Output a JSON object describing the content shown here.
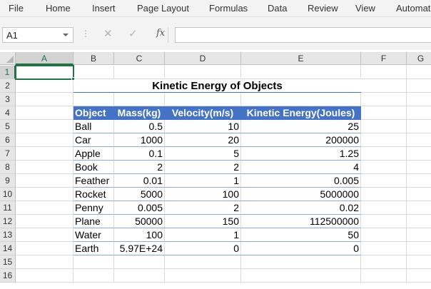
{
  "menu": [
    "File",
    "Home",
    "Insert",
    "Page Layout",
    "Formulas",
    "Data",
    "Review",
    "View",
    "Automat"
  ],
  "formula_bar": {
    "name_box": "A1",
    "cancel_icon": "✕",
    "enter_icon": "✓",
    "fx_label": "fx",
    "formula": ""
  },
  "columns": [
    "A",
    "B",
    "C",
    "D",
    "E",
    "F",
    "G"
  ],
  "rows": [
    "1",
    "2",
    "3",
    "4",
    "5",
    "6",
    "7",
    "8",
    "9",
    "10",
    "11",
    "12",
    "13",
    "14",
    "15",
    "16"
  ],
  "sheet": {
    "title": "Kinetic Energy of Objects",
    "headers": [
      "Object",
      "Mass(kg)",
      "Velocity(m/s)",
      "Kinetic Energy(Joules)"
    ],
    "data": [
      [
        "Ball",
        "0.5",
        "10",
        "25"
      ],
      [
        "Car",
        "1000",
        "20",
        "200000"
      ],
      [
        "Apple",
        "0.1",
        "5",
        "1.25"
      ],
      [
        "Book",
        "2",
        "2",
        "4"
      ],
      [
        "Feather",
        "0.01",
        "1",
        "0.005"
      ],
      [
        "Rocket",
        "5000",
        "100",
        "5000000"
      ],
      [
        "Penny",
        "0.005",
        "2",
        "0.02"
      ],
      [
        "Plane",
        "50000",
        "150",
        "112500000"
      ],
      [
        "Water",
        "100",
        "1",
        "50"
      ],
      [
        "Earth",
        "5.97E+24",
        "0",
        "0"
      ]
    ]
  },
  "colors": {
    "accent": "#217346",
    "table_header": "#4472c4",
    "table_border": "#8ea9db"
  }
}
